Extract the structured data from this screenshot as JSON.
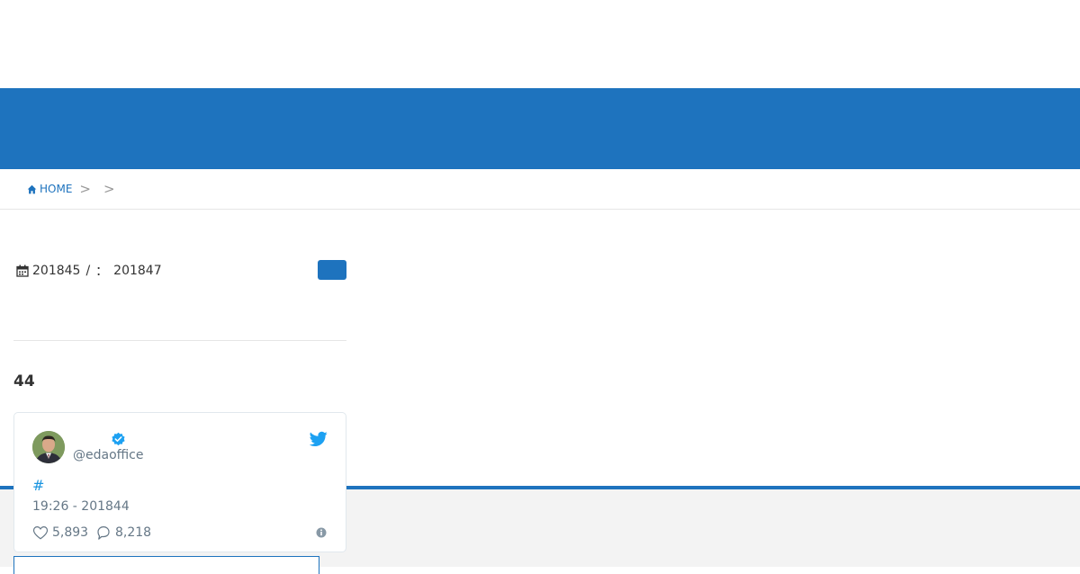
{
  "breadcrumb": {
    "home_label": "HOME",
    "separator": ">"
  },
  "post_meta": {
    "published_date": "201845",
    "date_separator": "/",
    "updated_label": "：",
    "updated_date": "201847"
  },
  "section": {
    "count_heading": "44"
  },
  "tweet": {
    "handle": "@edaoffice",
    "hashtag": "#",
    "timestamp": "19:26 - 201844",
    "like_count": "5,893",
    "reply_count": "8,218"
  },
  "colors": {
    "brand_blue": "#1e73be",
    "twitter_blue": "#1da1f2",
    "muted_text": "#657786"
  },
  "icons": {
    "home": "home-icon",
    "calendar": "calendar-icon",
    "verified": "verified-badge-icon",
    "twitter": "twitter-bird-icon",
    "like": "heart-icon",
    "reply": "speech-bubble-icon",
    "info": "info-icon"
  }
}
